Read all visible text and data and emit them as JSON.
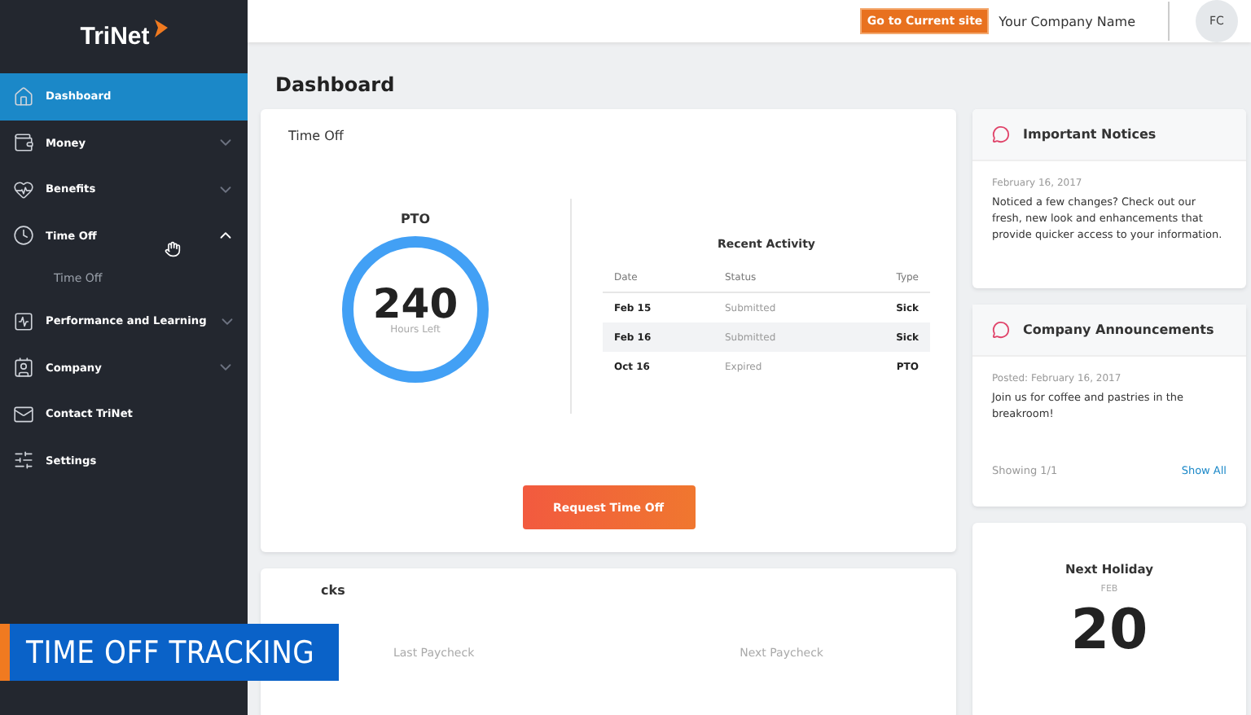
{
  "sidebar": {
    "logo": "TriNet",
    "items": [
      {
        "label": "Dashboard",
        "selected": true
      },
      {
        "label": "Money",
        "selected": false,
        "expanded": false
      },
      {
        "label": "Benefits",
        "selected": false,
        "expanded": false
      },
      {
        "label": "Time Off",
        "selected": false,
        "expanded": true,
        "children": [
          {
            "label": "Time Off",
            "selected": false
          }
        ]
      },
      {
        "label": "Performance and Learning",
        "selected": false,
        "expanded": false
      },
      {
        "label": "Company",
        "selected": false,
        "expanded": false
      },
      {
        "label": "Contact TriNet",
        "selected": false
      },
      {
        "label": "Settings",
        "selected": false
      }
    ]
  },
  "topbar": {
    "site_button": "Go to Current site",
    "company": "Your Company Name",
    "avatar": "FC"
  },
  "page_title": "Dashboard",
  "time_off": {
    "title": "Time Off",
    "pto": {
      "label": "PTO",
      "value": "240",
      "caption": "Hours Left"
    },
    "recent": {
      "title": "Recent Activity",
      "columns": [
        "Date",
        "Status",
        "Type"
      ],
      "rows": [
        {
          "date": "Feb 15",
          "status": "Submitted",
          "type": "Sick"
        },
        {
          "date": "Feb 16",
          "status": "Submitted",
          "type": "Sick"
        },
        {
          "date": "Oct 16",
          "status": "Expired",
          "type": "PTO"
        }
      ]
    },
    "button": "Request Time Off"
  },
  "paychecks": {
    "title": "cks",
    "columns": [
      "Last Paycheck",
      "Next Paycheck"
    ]
  },
  "notices": {
    "title": "Important Notices",
    "date": "February 16, 2017",
    "text": "Noticed a few changes? Check out our fresh, new look and enhancements that provide quicker access to your information."
  },
  "announcements": {
    "title": "Company Announcements",
    "date": "Posted: February 16, 2017",
    "text": "Join us for coffee and pastries in the breakroom!",
    "count": "Showing 1/1",
    "link": "Show All"
  },
  "holiday": {
    "title": "Next Holiday",
    "month": "FEB",
    "day": "20"
  },
  "caption": "TIME OFF TRACKING"
}
